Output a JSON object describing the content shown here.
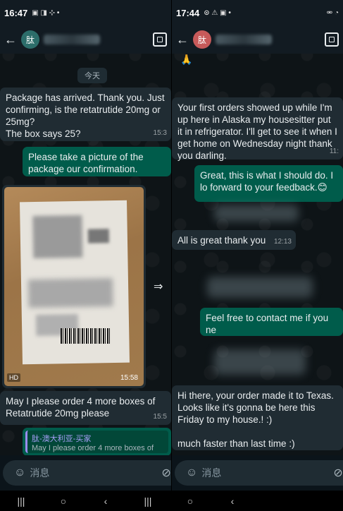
{
  "left": {
    "status_time": "16:47",
    "avatar_text": "肽",
    "day_chip": "今天",
    "messages": [
      {
        "text": "Package has arrived. Thank you. Just confirming, is the retatrutide 20mg or 25mg?\nThe box says 25?",
        "time": "15:3"
      },
      {
        "text": "Please take a picture of the package our confirmation.",
        "time": ""
      },
      {
        "text": "May I please order 4 more boxes of Retatrutide 20mg please",
        "time": "15:5"
      }
    ],
    "photo_time": "15:58",
    "photo_badge": "HD",
    "reply_name": "肽-澳大利亚-买家",
    "reply_text": "May I please order 4 more boxes of",
    "input_placeholder": "消息"
  },
  "right": {
    "status_time": "17:44",
    "avatar_text": "肽",
    "messages": [
      {
        "text": "Your first orders showed up while I'm up here in Alaska my housesitter put it in refrigerator. I'll get to see it when I get home on Wednesday night thank you darling.",
        "time": "11:"
      },
      {
        "text": "Great, this is what I should do. I lo forward to your feedback.😊",
        "time": ""
      },
      {
        "text": "All is great thank you",
        "time": "12:13"
      },
      {
        "text": "Feel free to contact me if you ne",
        "time": ""
      },
      {
        "text": "Hi there, your order made it to Texas. Looks like it's gonna be here this Friday to my house.! :)\n\nmuch faster than last time :)",
        "time": ""
      }
    ],
    "input_placeholder": "消息"
  },
  "nav": [
    "|||",
    "○",
    "‹",
    "|||",
    "○",
    "‹"
  ]
}
